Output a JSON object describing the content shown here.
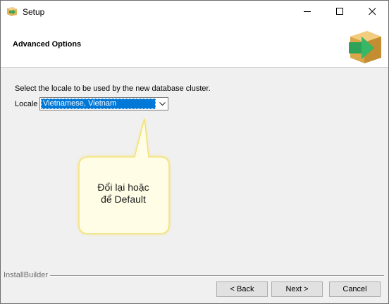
{
  "window": {
    "title": "Setup",
    "icon": "installer-box-icon",
    "controls": [
      "minimize-icon",
      "maximize-icon",
      "close-icon"
    ]
  },
  "header": {
    "title": "Advanced Options",
    "logo": "installer-box-arrow-icon"
  },
  "content": {
    "instruction": "Select the locale to be used by the new database cluster.",
    "locale_label": "Locale",
    "locale_value": "Vietnamese, Vietnam"
  },
  "callout": {
    "line1": "Đổi lại hoặc",
    "line2": "để Default"
  },
  "footer": {
    "brand": "InstallBuilder",
    "back_label": "< Back",
    "next_label": "Next >",
    "cancel_label": "Cancel"
  },
  "colors": {
    "selection": "#0078d7",
    "callout_fill": "#fffde6",
    "callout_border": "#f3e27a"
  }
}
